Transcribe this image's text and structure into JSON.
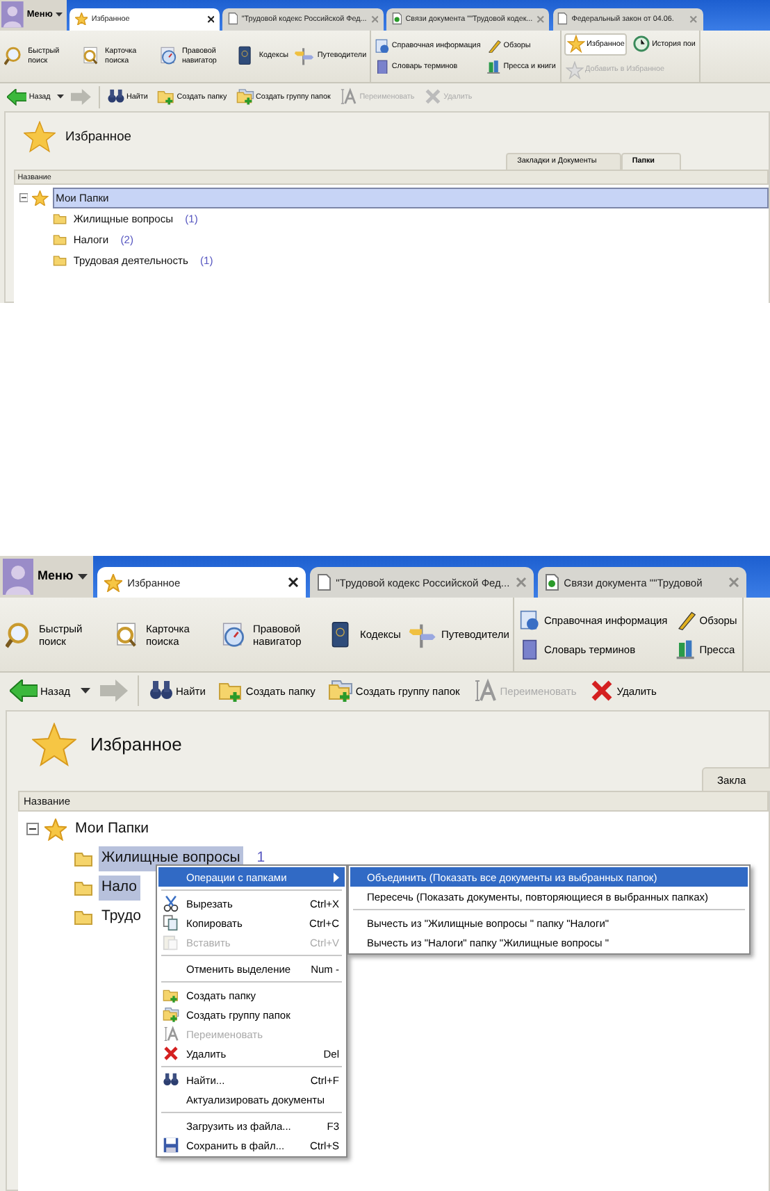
{
  "screens": [
    {
      "menu_button": {
        "label": "Меню"
      },
      "tabs": [
        {
          "label": "Избранное",
          "selected": true
        },
        {
          "label": "\"Трудовой кодекс Российской Фед...",
          "selected": false
        },
        {
          "label": "Связи документа \"\"Трудовой кодек...",
          "selected": false
        },
        {
          "label": "Федеральный закон от 04.06.",
          "selected": false
        }
      ],
      "ribbon": {
        "large_buttons": [
          {
            "label": "Быстрый поиск"
          },
          {
            "label": "Карточка поиска"
          },
          {
            "label": "Правовой навигатор"
          },
          {
            "label": "Кодексы"
          },
          {
            "label": "Путеводители"
          }
        ],
        "reference_buttons": [
          {
            "label": "Справочная информация"
          },
          {
            "label": "Обзоры"
          },
          {
            "label": "Словарь терминов"
          },
          {
            "label": "Пресса и книги"
          }
        ],
        "favorites_buttons": [
          {
            "label": "Избранное",
            "selected": true,
            "disabled": false
          },
          {
            "label": "История пои",
            "selected": false,
            "disabled": false
          },
          {
            "label": "Добавить в Избранное",
            "selected": false,
            "disabled": true
          }
        ]
      },
      "toolbar": {
        "back": {
          "label": "Назад"
        },
        "buttons": [
          {
            "label": "Найти",
            "disabled": false
          },
          {
            "label": "Создать папку",
            "disabled": false
          },
          {
            "label": "Создать группу папок",
            "disabled": false
          },
          {
            "label": "Переименовать",
            "disabled": true
          },
          {
            "label": "Удалить",
            "disabled": true
          }
        ]
      },
      "panel": {
        "title": "Избранное",
        "view_tabs": [
          {
            "label": "Закладки и Документы",
            "selected": false
          },
          {
            "label": "Папки",
            "selected": true
          }
        ],
        "column": "Название",
        "tree": [
          {
            "label": "Мои Папки",
            "selected": true,
            "expanded": true,
            "children": [
              {
                "label": "Жилищные вопросы",
                "count": "(1)",
                "selected": false
              },
              {
                "label": "Налоги",
                "count": "(2)",
                "selected": false
              },
              {
                "label": "Трудовая деятельность",
                "count": "(1)",
                "selected": false
              }
            ]
          }
        ]
      }
    },
    {
      "menu_button": {
        "label": "Меню"
      },
      "tabs": [
        {
          "label": "Избранное",
          "selected": true
        },
        {
          "label": "\"Трудовой кодекс Российской Фед...",
          "selected": false
        },
        {
          "label": "Связи документа \"\"Трудовой",
          "selected": false
        }
      ],
      "ribbon": {
        "large_buttons": [
          {
            "label": "Быстрый поиск"
          },
          {
            "label": "Карточка поиска"
          },
          {
            "label": "Правовой навигатор"
          },
          {
            "label": "Кодексы"
          },
          {
            "label": "Путеводители"
          }
        ],
        "reference_buttons": [
          {
            "label": "Справочная информация"
          },
          {
            "label": "Обзоры"
          },
          {
            "label": "Словарь терминов"
          },
          {
            "label": "Пресса"
          }
        ]
      },
      "toolbar": {
        "back": {
          "label": "Назад"
        },
        "buttons": [
          {
            "label": "Найти",
            "disabled": false
          },
          {
            "label": "Создать папку",
            "disabled": false
          },
          {
            "label": "Создать группу папок",
            "disabled": false
          },
          {
            "label": "Переименовать",
            "disabled": true
          },
          {
            "label": "Удалить",
            "disabled": false
          }
        ]
      },
      "panel": {
        "title": "Избранное",
        "view_tabs": [
          {
            "label": "Закла",
            "selected": false
          }
        ],
        "column": "Название",
        "tree": [
          {
            "label": "Мои Папки",
            "selected": false,
            "expanded": true,
            "children": [
              {
                "label": "Жилищные вопросы",
                "count": "1",
                "selected": true
              },
              {
                "label": "Нало",
                "selected": true
              },
              {
                "label": "Трудо",
                "selected": false
              }
            ]
          }
        ]
      },
      "context_menu": {
        "items": [
          {
            "kind": "item",
            "label": "Операции с папками",
            "selected": true,
            "disabled": false,
            "submenu": true
          },
          {
            "kind": "separator"
          },
          {
            "kind": "item",
            "label": "Вырезать",
            "shortcut": "Ctrl+X",
            "selected": false,
            "disabled": false
          },
          {
            "kind": "item",
            "label": "Копировать",
            "shortcut": "Ctrl+C",
            "selected": false,
            "disabled": false
          },
          {
            "kind": "item",
            "label": "Вставить",
            "shortcut": "Ctrl+V",
            "selected": false,
            "disabled": true
          },
          {
            "kind": "separator"
          },
          {
            "kind": "item",
            "label": "Отменить выделение",
            "shortcut": "Num -",
            "selected": false,
            "disabled": false
          },
          {
            "kind": "separator"
          },
          {
            "kind": "item",
            "label": "Создать папку",
            "selected": false,
            "disabled": false
          },
          {
            "kind": "item",
            "label": "Создать группу папок",
            "selected": false,
            "disabled": false
          },
          {
            "kind": "item",
            "label": "Переименовать",
            "selected": false,
            "disabled": true
          },
          {
            "kind": "item",
            "label": "Удалить",
            "shortcut": "Del",
            "selected": false,
            "disabled": false
          },
          {
            "kind": "separator"
          },
          {
            "kind": "item",
            "label": "Найти...",
            "shortcut": "Ctrl+F",
            "selected": false,
            "disabled": false
          },
          {
            "kind": "item",
            "label": "Актуализировать документы",
            "selected": false,
            "disabled": false
          },
          {
            "kind": "separator"
          },
          {
            "kind": "item",
            "label": "Загрузить из файла...",
            "shortcut": "F3",
            "selected": false,
            "disabled": false
          },
          {
            "kind": "item",
            "label": "Сохранить в файл...",
            "shortcut": "Ctrl+S",
            "selected": false,
            "disabled": false
          }
        ],
        "submenu": [
          {
            "kind": "item",
            "label": "Объединить (Показать все документы из выбранных папок)",
            "selected": true
          },
          {
            "kind": "item",
            "label": "Пересечь (Показать документы, повторяющиеся в выбранных папках)",
            "selected": false
          },
          {
            "kind": "separator"
          },
          {
            "kind": "item",
            "label": "Вычесть из \"Жилищные вопросы \" папку \"Налоги\"",
            "selected": false
          },
          {
            "kind": "item",
            "label": "Вычесть из \"Налоги\" папку \"Жилищные вопросы \"",
            "selected": false
          }
        ]
      }
    }
  ]
}
